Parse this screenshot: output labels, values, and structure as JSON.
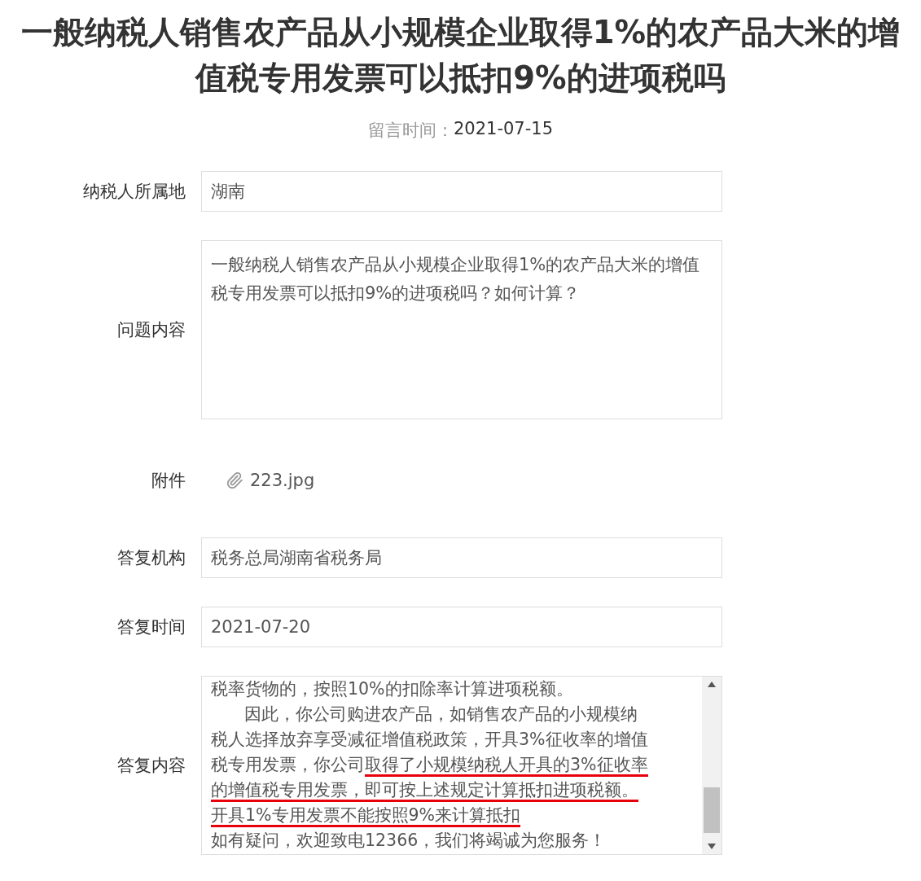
{
  "title": "一般纳税人销售农产品从小规模企业取得1%的农产品大米的增值税专用发票可以抵扣9%的进项税吗",
  "meta": {
    "label": "留言时间：",
    "value": "2021-07-15"
  },
  "fields": [
    {
      "kind": "input",
      "label": "纳税人所属地",
      "value": "湖南"
    },
    {
      "kind": "textarea",
      "label": "问题内容",
      "value": "一般纳税人销售农产品从小规模企业取得1%的农产品大米的增值税专用发票可以抵扣9%的进项税吗？如何计算？"
    },
    {
      "kind": "attachment",
      "label": "附件",
      "value": "223.jpg"
    },
    {
      "kind": "input",
      "label": "答复机构",
      "value": "税务总局湖南省税务局"
    },
    {
      "kind": "input",
      "label": "答复时间",
      "value": "2021-07-20"
    },
    {
      "kind": "answer",
      "label": "答复内容",
      "lines": [
        {
          "indented": false,
          "segments": [
            {
              "text": "税率货物的，按照10%的扣除率计算进项税额。",
              "underlined": false
            }
          ]
        },
        {
          "indented": true,
          "segments": [
            {
              "text": "因此，你公司购进农产品，如销售农产品的小规模纳",
              "underlined": false
            }
          ]
        },
        {
          "indented": false,
          "segments": [
            {
              "text": "税人选择放弃享受减征增值税政策，开具3%征收率的增值",
              "underlined": false
            }
          ]
        },
        {
          "indented": false,
          "segments": [
            {
              "text": "税专用发票，你公司",
              "underlined": false
            },
            {
              "text": "取得了小规模纳税人开具的3%征收率",
              "underlined": true
            }
          ]
        },
        {
          "indented": false,
          "segments": [
            {
              "text": "的增值税专用发票，即可按上述规定计算抵扣进项税额。",
              "underlined": true
            }
          ]
        },
        {
          "indented": false,
          "segments": [
            {
              "text": "开具1%专用发票不能按照9%来计算抵扣",
              "underlined": true
            }
          ]
        },
        {
          "indented": false,
          "segments": [
            {
              "text": "如有疑问，欢迎致电12366，我们将竭诚为您服务！",
              "underlined": false
            }
          ]
        }
      ]
    }
  ]
}
